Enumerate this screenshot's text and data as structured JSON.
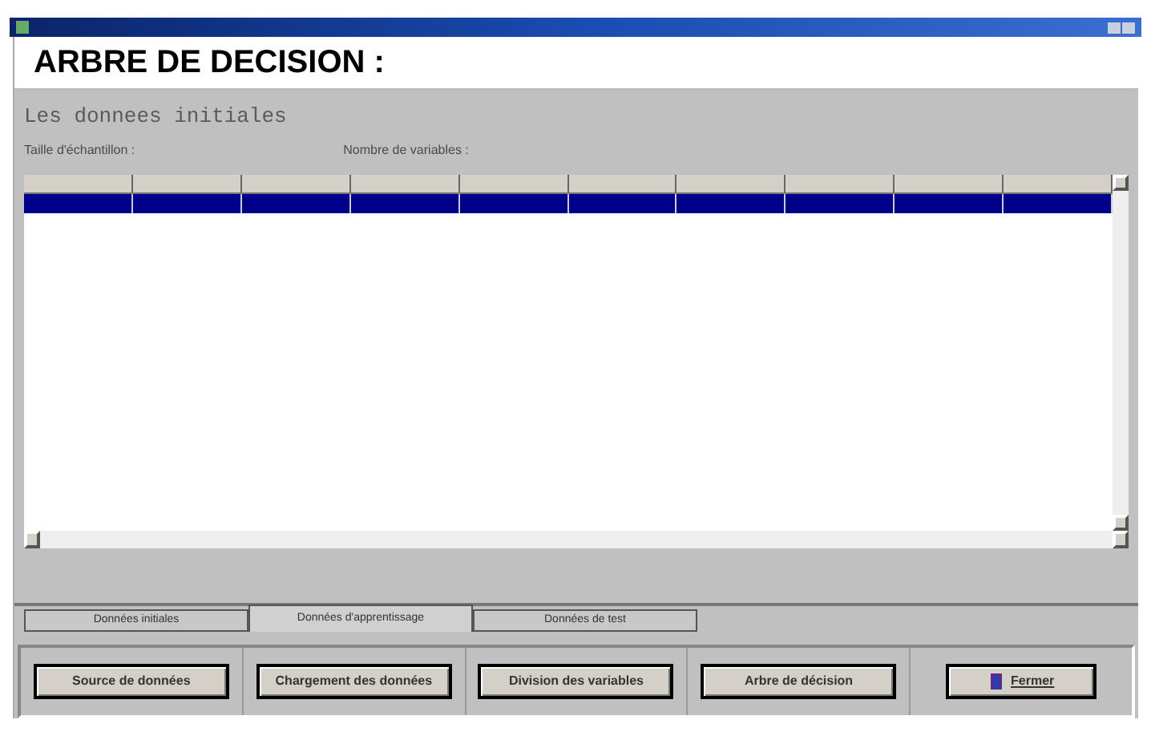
{
  "header": {
    "title": "ARBRE DE DECISION :"
  },
  "panel": {
    "title": "Les donnees initiales",
    "fields": [
      {
        "label": "Taille d'échantillon :"
      },
      {
        "label": "Nombre de variables :"
      }
    ]
  },
  "table": {
    "rows": [
      {
        "selected": true
      }
    ]
  },
  "tabs": [
    {
      "label": "Données initiales",
      "selected": false
    },
    {
      "label": "Données d'apprentissage",
      "selected": true
    },
    {
      "label": "Données de test",
      "selected": false
    }
  ],
  "buttons": [
    {
      "label": "Source  de données",
      "kind": "plain"
    },
    {
      "label": "Chargement des données",
      "kind": "plain"
    },
    {
      "label": "Division des variables",
      "kind": "plain"
    },
    {
      "label": "Arbre de décision",
      "kind": "plain"
    },
    {
      "label": "Fermer",
      "kind": "close"
    }
  ]
}
